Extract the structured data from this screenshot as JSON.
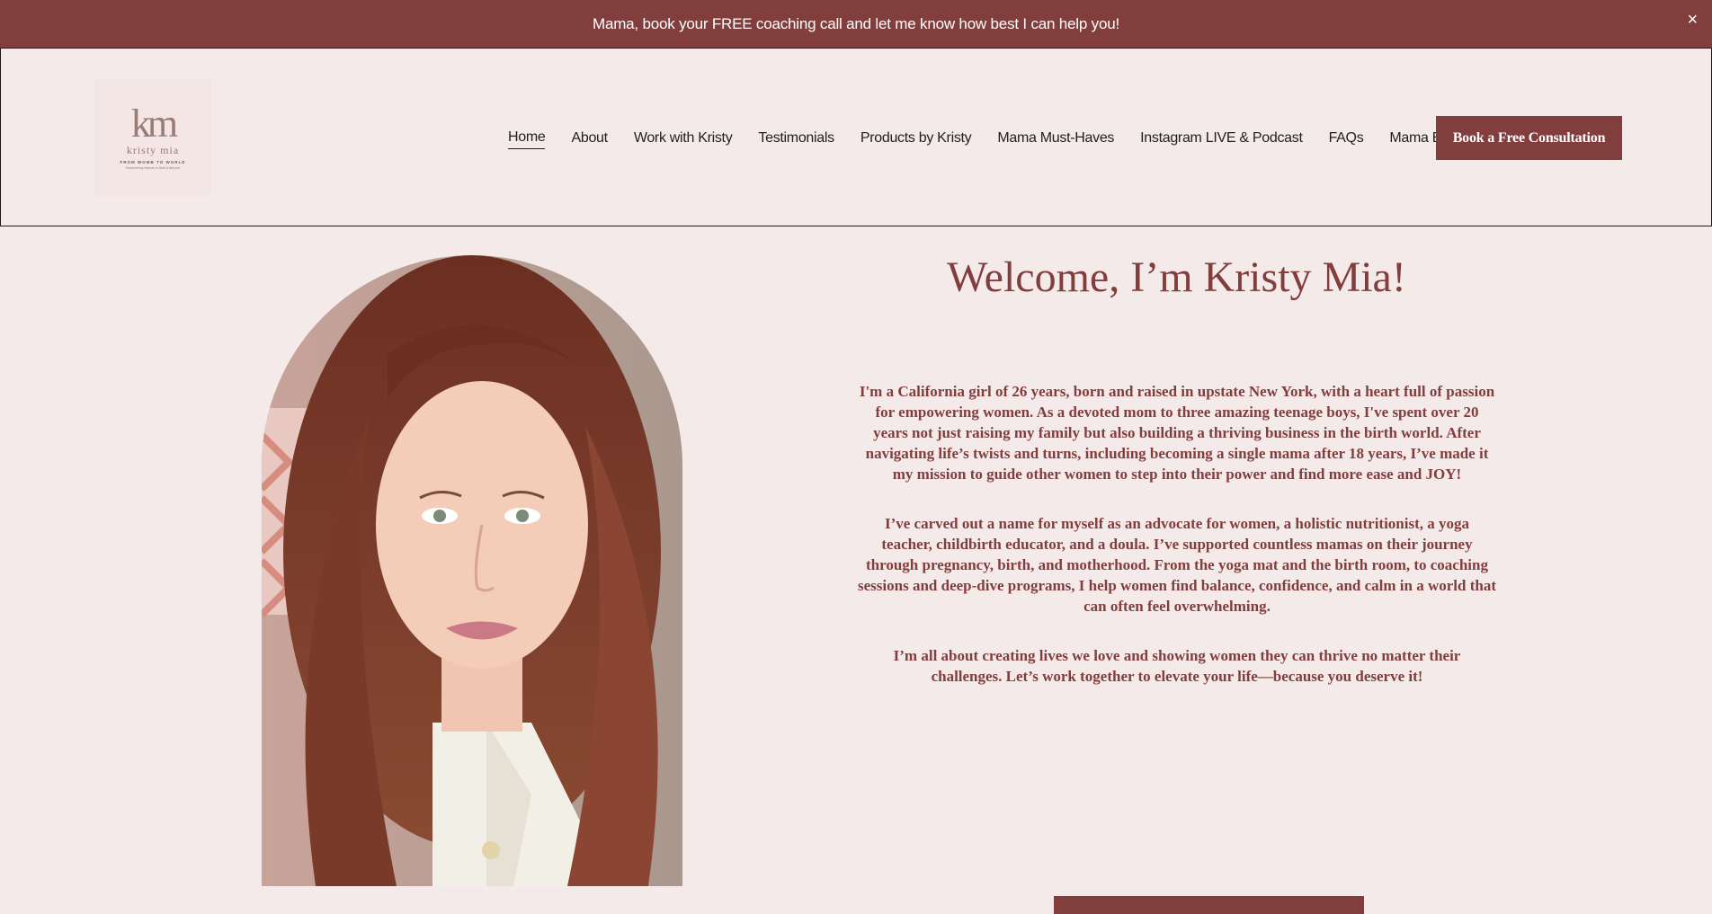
{
  "announcement": {
    "text": "Mama, book your FREE coaching call and let me know how best I can help you!",
    "close_glyph": "×"
  },
  "logo": {
    "monogram": "km",
    "name": "kristy mia",
    "tagline": "FROM WOMB TO WORLD",
    "subline": "Empowering Mamas in Birth & Beyond"
  },
  "nav": {
    "items": [
      {
        "label": "Home",
        "active": true
      },
      {
        "label": "About"
      },
      {
        "label": "Work with Kristy"
      },
      {
        "label": "Testimonials"
      },
      {
        "label": "Products by Kristy"
      },
      {
        "label": "Mama Must-Haves"
      },
      {
        "label": "Instagram LIVE & Podcast"
      },
      {
        "label": "FAQs"
      },
      {
        "label": "Mama Blog"
      }
    ],
    "cta_label": "Book a Free Consultation"
  },
  "hero": {
    "title": "Welcome, I’m Kristy Mia!",
    "paragraphs": [
      "I'm a California girl of 26 years, born and raised in upstate New York, with a heart full of passion for empowering women. As a devoted mom to three amazing teenage boys, I've spent over 20 years not just raising my family but also building a thriving business in the birth world. After navigating life’s twists and turns, including becoming a single mama after 18 years, I’ve made it my mission to guide other women to step into their power and find more ease and JOY!",
      "I’ve carved out a name for myself as an advocate for women, a holistic nutritionist, a yoga teacher, childbirth educator, and a doula. I’ve supported countless mamas on their journey through pregnancy, birth, and motherhood. From the yoga mat and the birth room, to coaching sessions and deep-dive programs, I help women find balance, confidence, and calm in a world that can often feel overwhelming.",
      "I’m all about creating lives we love and showing women they can thrive no matter their challenges. Let’s work together to elevate your life—because you deserve it!"
    ]
  },
  "colors": {
    "brand": "#823d3d",
    "background": "#f5eaea"
  }
}
